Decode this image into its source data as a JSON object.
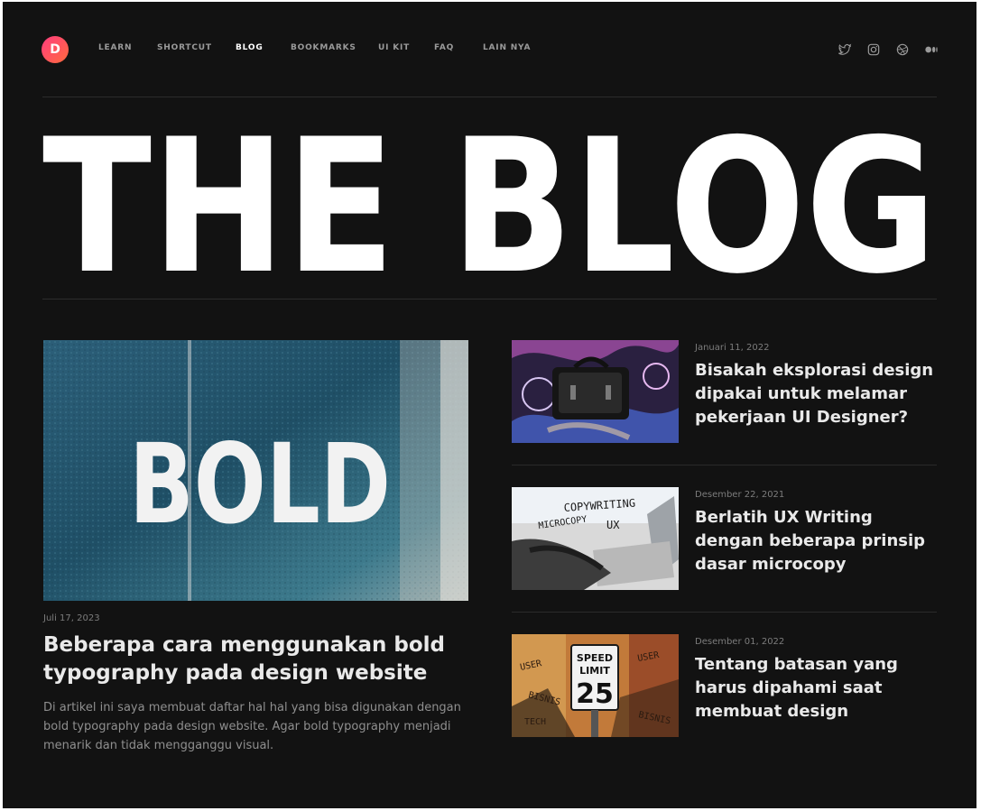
{
  "brand": {
    "logo_letter": "D",
    "accent": "#ff4a6e"
  },
  "nav": {
    "items": [
      {
        "label": "LEARN"
      },
      {
        "label": "SHORTCUT"
      },
      {
        "label": "BLOG",
        "active": true
      },
      {
        "label": "BOOKMARKS"
      },
      {
        "label": "UI KIT"
      },
      {
        "label": "FAQ"
      },
      {
        "label": "LAIN NYA"
      }
    ],
    "social_icons": [
      "twitter-icon",
      "instagram-icon",
      "dribbble-icon",
      "medium-icon"
    ]
  },
  "hero": {
    "title": "THE BLOG"
  },
  "featured": {
    "image_text": "BOLD",
    "date": "Juli 17, 2023",
    "title": "Beberapa cara menggunakan bold typography pada design website",
    "excerpt": "Di artikel ini saya membuat daftar hal hal yang bisa digunakan dengan bold typography pada design website. Agar bold typography menjadi menarik dan tidak mengganggu visual."
  },
  "posts": [
    {
      "date": "Januari 11, 2022",
      "title": "Bisakah eksplorasi design dipakai untuk melamar pekerjaan UI Designer?"
    },
    {
      "date": "Desember 22, 2021",
      "title": "Berlatih UX Writing dengan beberapa prinsip dasar microcopy",
      "image_texts": {
        "a": "COPYWRITING",
        "b": "MICROCOPY",
        "c": "UX"
      }
    },
    {
      "date": "Desember 01, 2022",
      "title": "Tentang batasan yang harus dipahami saat membuat design",
      "image_texts": {
        "sign_line1": "SPEED",
        "sign_line2": "LIMIT",
        "sign_number": "25",
        "w1": "USER",
        "w2": "BISNIS",
        "w3": "TECH"
      }
    }
  ]
}
